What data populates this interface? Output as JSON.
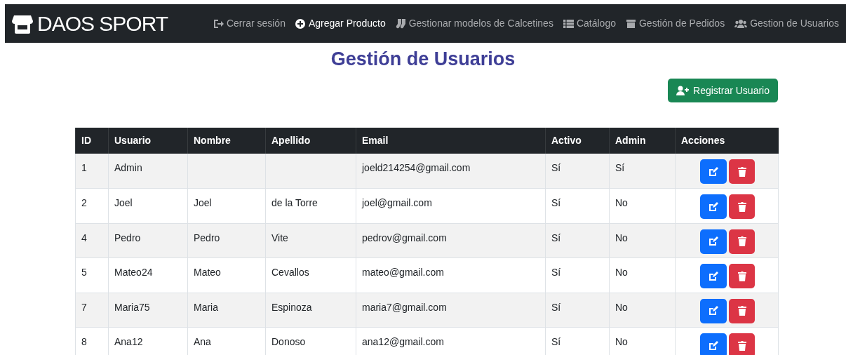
{
  "navbar": {
    "brand": "DAOS SPORT",
    "links": [
      {
        "label": "Cerrar sesión",
        "kind": "logout",
        "selected": false
      },
      {
        "label": "Agregar Producto",
        "kind": "add",
        "selected": true
      },
      {
        "label": "Gestionar modelos de Calcetines",
        "kind": "socks",
        "selected": false
      },
      {
        "label": "Catálogo",
        "kind": "catalog",
        "selected": false
      },
      {
        "label": "Gestión de Pedidos",
        "kind": "orders",
        "selected": false
      },
      {
        "label": "Gestion de Usuarios",
        "kind": "users",
        "selected": false
      }
    ]
  },
  "title": "Gestión de Usuarios",
  "register_button": "Registrar Usuario",
  "table": {
    "columns": [
      "ID",
      "Usuario",
      "Nombre",
      "Apellido",
      "Email",
      "Activo",
      "Admin",
      "Acciones"
    ],
    "rows": [
      [
        "1",
        "Admin",
        "",
        "",
        "joeld214254@gmail.com",
        "Sí",
        "Sí"
      ],
      [
        "2",
        "Joel",
        "Joel",
        "de la Torre",
        "joel@gmail.com",
        "Sí",
        "No"
      ],
      [
        "4",
        "Pedro",
        "Pedro",
        "Vite",
        "pedrov@gmail.com",
        "Sí",
        "No"
      ],
      [
        "5",
        "Mateo24",
        "Mateo",
        "Cevallos",
        "mateo@gmail.com",
        "Sí",
        "No"
      ],
      [
        "7",
        "Maria75",
        "Maria",
        "Espinoza",
        "maria7@gmail.com",
        "Sí",
        "No"
      ],
      [
        "8",
        "Ana12",
        "Ana",
        "Donoso",
        "ana12@gmail.com",
        "Sí",
        "No"
      ]
    ]
  }
}
